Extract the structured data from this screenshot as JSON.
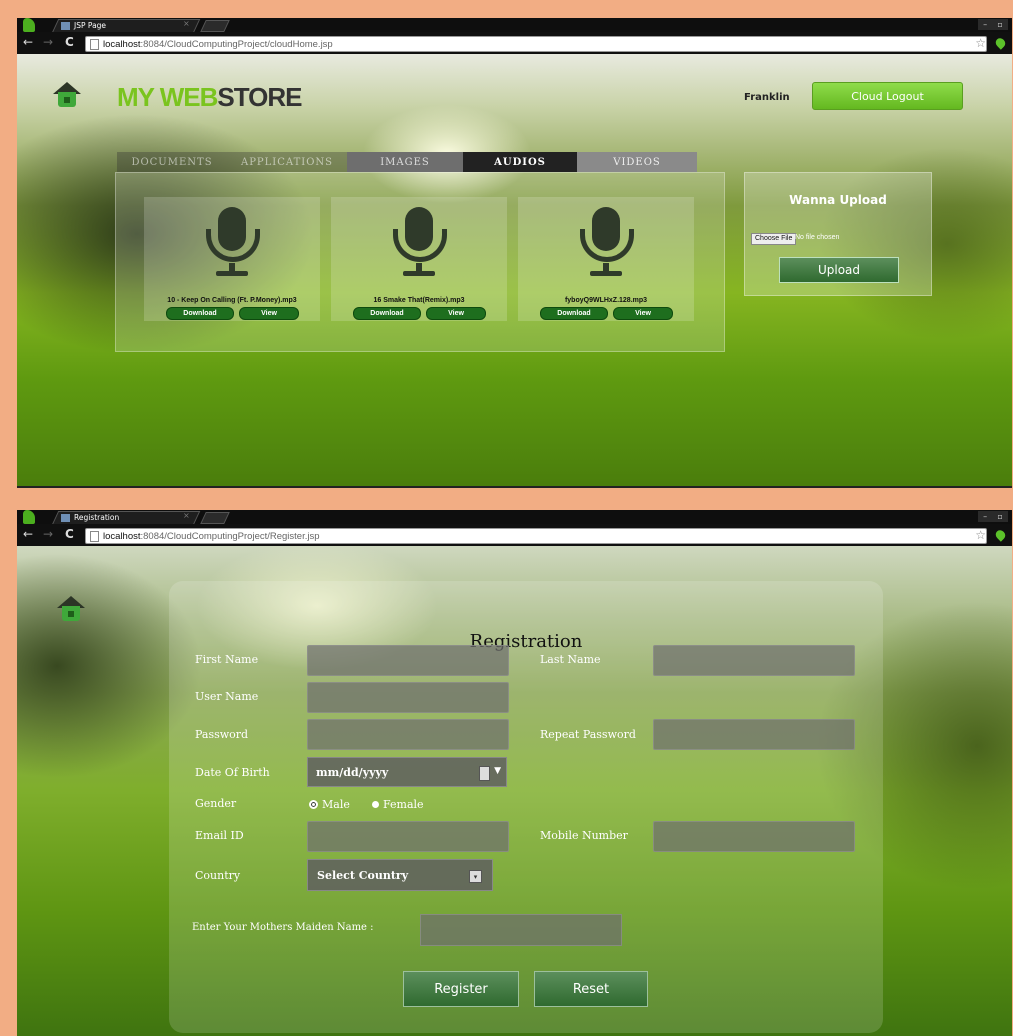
{
  "window1": {
    "tab_title": "JSP Page",
    "url_host": "localhost",
    "url_path": ":8084/CloudComputingProject/cloudHome.jsp",
    "brand_part1": "MY WEB",
    "brand_part2": "STORE",
    "username": "Franklin",
    "logout_label": "Cloud Logout",
    "tabs": [
      "DOCUMENTS",
      "APPLICATIONS",
      "IMAGES",
      "AUDIOS",
      "VIDEOS"
    ],
    "active_tab": "AUDIOS",
    "files": [
      {
        "name": "10 - Keep On Calling (Ft. P.Money).mp3",
        "download": "Download",
        "view": "View"
      },
      {
        "name": "16 Smake That(Remix).mp3",
        "download": "Download",
        "view": "View"
      },
      {
        "name": "fyboyQ9WLHxZ.128.mp3",
        "download": "Download",
        "view": "View"
      }
    ],
    "upload": {
      "title": "Wanna Upload",
      "choose_label": "Choose File",
      "no_file": "No file chosen",
      "button": "Upload"
    }
  },
  "window2": {
    "tab_title": "Registration",
    "url_host": "localhost",
    "url_path": ":8084/CloudComputingProject/Register.jsp",
    "title": "Registration",
    "labels": {
      "first_name": "First Name",
      "last_name": "Last Name",
      "user_name": "User Name",
      "password": "Password",
      "repeat_password": "Repeat Password",
      "dob": "Date Of Birth",
      "gender": "Gender",
      "email": "Email ID",
      "mobile": "Mobile Number",
      "country": "Country",
      "maiden": "Enter Your Mothers Maiden Name :"
    },
    "dob_placeholder": "mm/dd/yyyy",
    "gender_options": [
      "Male",
      "Female"
    ],
    "country_selected": "Select Country",
    "register_button": "Register",
    "reset_button": "Reset"
  },
  "colors": {
    "page_border": "#f2ad84",
    "brand_green": "#7ac41e",
    "logout_green": "#64b820",
    "button_green": "#2f6a2f"
  }
}
